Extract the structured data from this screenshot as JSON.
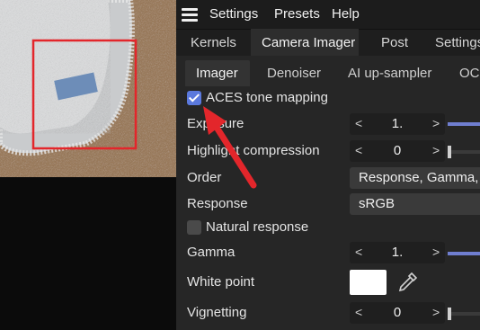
{
  "menubar": {
    "items": [
      "Settings",
      "Presets",
      "Help"
    ]
  },
  "tabs_primary": [
    "Kernels",
    "Camera Imager",
    "Post",
    "Settings"
  ],
  "tabs_secondary": [
    "Imager",
    "Denoiser",
    "AI up-sampler",
    "OCI"
  ],
  "imager": {
    "aces": {
      "label": "ACES tone mapping",
      "checked": true
    },
    "exposure": {
      "label": "Exposure",
      "value": "1."
    },
    "highlight": {
      "label": "Highlight compression",
      "value": "0"
    },
    "order": {
      "label": "Order",
      "value": "Response, Gamma, L"
    },
    "response": {
      "label": "Response",
      "value": "sRGB"
    },
    "natural": {
      "label": "Natural response",
      "checked": false
    },
    "gamma": {
      "label": "Gamma",
      "value": "1."
    },
    "white_point": {
      "label": "White point",
      "color": "#ffffff"
    },
    "vignetting": {
      "label": "Vignetting",
      "value": "0"
    }
  },
  "icons": {
    "menu": "hamburger-icon",
    "arrow_left": "chevron-left-icon",
    "arrow_right": "chevron-right-icon",
    "picker": "eyedropper-icon"
  },
  "colors": {
    "accent": "#5b79dd",
    "highlight_box": "#e3262b",
    "annotation_arrow": "#e3262b"
  }
}
